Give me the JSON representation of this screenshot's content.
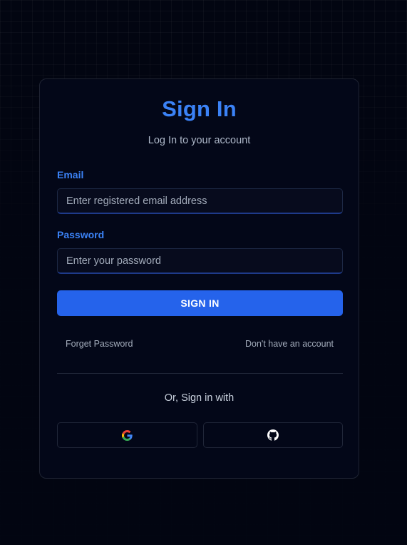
{
  "header": {
    "title": "Sign In",
    "subtitle": "Log In to your account"
  },
  "form": {
    "email": {
      "label": "Email",
      "placeholder": "Enter registered email address",
      "value": ""
    },
    "password": {
      "label": "Password",
      "placeholder": "Enter your password",
      "value": ""
    },
    "submit_label": "SIGN IN"
  },
  "links": {
    "forgot_password": "Forget Password",
    "no_account": "Don't have an account"
  },
  "social": {
    "divider_text": "Or, Sign in with",
    "providers": [
      {
        "icon": "google-icon"
      },
      {
        "icon": "github-icon"
      }
    ]
  },
  "colors": {
    "background": "#020511",
    "card": "#030718",
    "accent": "#3b82f6",
    "button": "#2563eb",
    "muted_text": "#a3acbb"
  }
}
